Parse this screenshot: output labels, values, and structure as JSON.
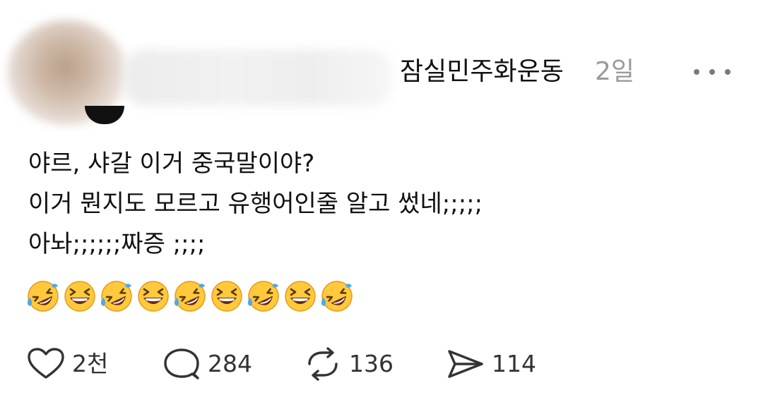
{
  "post": {
    "display_name": "잠실민주화운동",
    "time": "2일",
    "lines": [
      "야르, 샤갈 이거 중국말이야?",
      "이거 뭔지도 모르고 유행어인줄 알고 썼네;;;;;",
      "아놔;;;;;;짜증 ;;;;"
    ],
    "emojis": [
      "🤣",
      "😆",
      "🤣",
      "😆",
      "🤣",
      "😆",
      "🤣",
      "😆",
      "🤣"
    ]
  },
  "actions": {
    "likes": "2천",
    "replies": "284",
    "reposts": "136",
    "shares": "114"
  },
  "icons": {
    "like": "heart-icon",
    "reply": "speech-bubble-icon",
    "repost": "repost-icon",
    "share": "send-icon",
    "more": "more-horizontal-icon",
    "laugh_tears": "rolling-on-floor-laughing-emoji",
    "grin_squint": "grinning-squinting-face-emoji"
  },
  "colors": {
    "text": "#111111",
    "muted": "#9a9a9a",
    "icon": "#333333"
  }
}
